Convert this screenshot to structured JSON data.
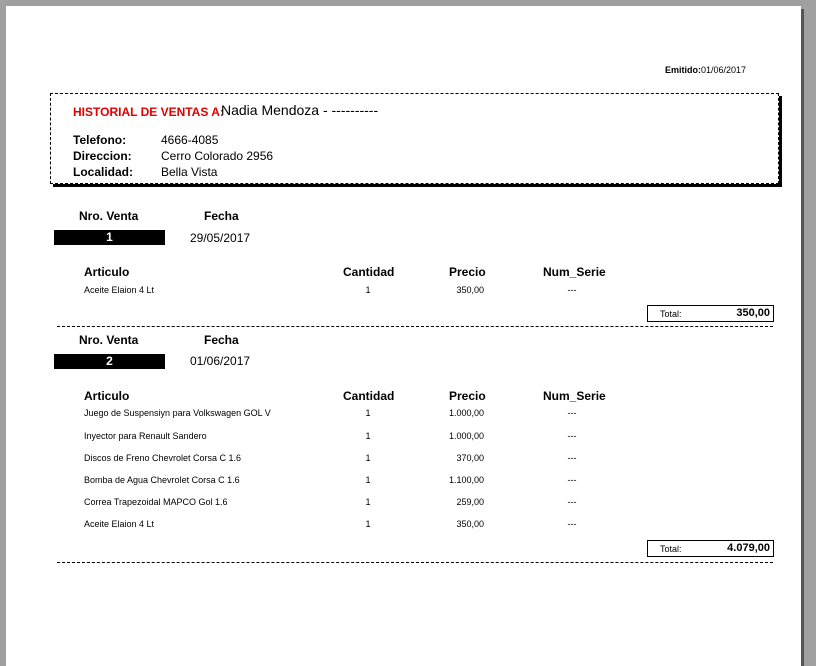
{
  "emitted": {
    "label": "Emitido:",
    "date": "01/06/2017"
  },
  "client": {
    "title": "HISTORIAL DE VENTAS A:",
    "name": "Nadia Mendoza - ----------",
    "fields": [
      {
        "label": "Telefono:",
        "value": "4666-4085"
      },
      {
        "label": "Direccion:",
        "value": "Cerro Colorado 2956"
      },
      {
        "label": "Localidad:",
        "value": "Bella Vista"
      }
    ]
  },
  "headers": {
    "sale_no": "Nro. Venta",
    "date": "Fecha",
    "article": "Articulo",
    "qty": "Cantidad",
    "price": "Precio",
    "serial": "Num_Serie",
    "total": "Total:"
  },
  "sales": [
    {
      "number": "1",
      "date": "29/05/2017",
      "total": "350,00",
      "items": [
        {
          "article": "Aceite Elaion 4 Lt",
          "qty": "1",
          "price": "350,00",
          "serial": "---"
        }
      ]
    },
    {
      "number": "2",
      "date": "01/06/2017",
      "total": "4.079,00",
      "items": [
        {
          "article": "Juego de Suspensiyn para Volkswagen GOL V",
          "qty": "1",
          "price": "1.000,00",
          "serial": "---"
        },
        {
          "article": "Inyector para Renault Sandero",
          "qty": "1",
          "price": "1.000,00",
          "serial": "---"
        },
        {
          "article": "Discos de Freno Chevrolet Corsa C 1.6",
          "qty": "1",
          "price": "370,00",
          "serial": "---"
        },
        {
          "article": "Bomba de Agua Chevrolet Corsa C 1.6",
          "qty": "1",
          "price": "1.100,00",
          "serial": "---"
        },
        {
          "article": "Correa Trapezoidal MAPCO Gol 1.6",
          "qty": "1",
          "price": "259,00",
          "serial": "---"
        },
        {
          "article": "Aceite Elaion 4 Lt",
          "qty": "1",
          "price": "350,00",
          "serial": "---"
        }
      ]
    }
  ]
}
